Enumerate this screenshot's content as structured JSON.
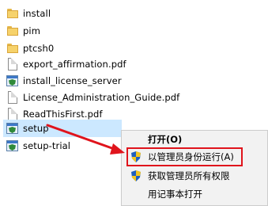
{
  "files": [
    {
      "name": "install",
      "type": "folder"
    },
    {
      "name": "pim",
      "type": "folder"
    },
    {
      "name": "ptcsh0",
      "type": "folder"
    },
    {
      "name": "export_affirmation.pdf",
      "type": "document"
    },
    {
      "name": "install_license_server",
      "type": "installer"
    },
    {
      "name": "License_Administration_Guide.pdf",
      "type": "document"
    },
    {
      "name": "ReadThisFirst.pdf",
      "type": "document"
    },
    {
      "name": "setup",
      "type": "installer",
      "selected": true
    },
    {
      "name": "setup-trial",
      "type": "installer"
    }
  ],
  "context_menu": {
    "items": [
      {
        "label": "打开(O)",
        "bold": true,
        "icon": null
      },
      {
        "label": "以管理员身份运行(A)",
        "bold": false,
        "icon": "uac-shield-icon",
        "highlighted": true
      },
      {
        "label": "获取管理员所有权限",
        "bold": false,
        "icon": "uac-shield-icon"
      },
      {
        "label": "用记事本打开",
        "bold": false,
        "icon": null
      }
    ]
  },
  "annotation": {
    "highlight_color": "#e0141c",
    "arrow_color": "#e0141c"
  }
}
